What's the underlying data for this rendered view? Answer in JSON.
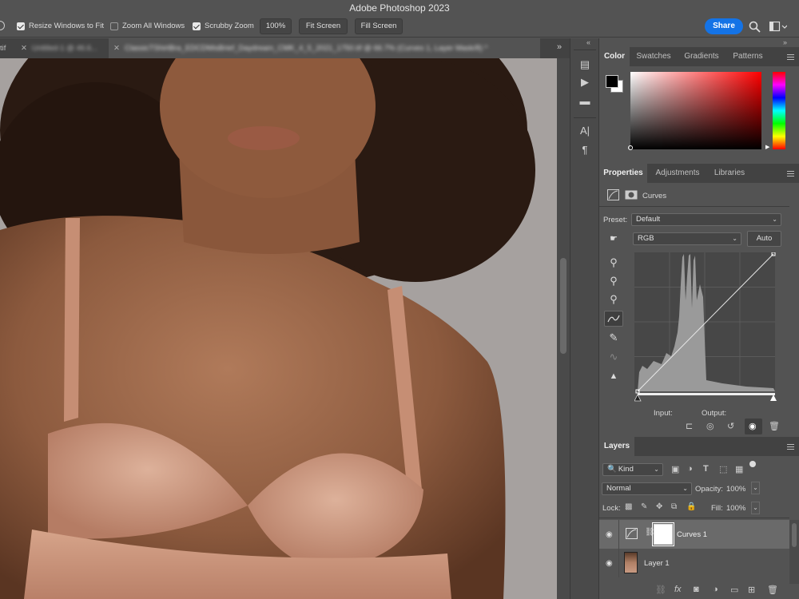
{
  "app": {
    "title": "Adobe Photoshop 2023"
  },
  "options_bar": {
    "resize_windows": {
      "label": "Resize Windows to Fit",
      "checked": true
    },
    "zoom_all": {
      "label": "Zoom All Windows",
      "checked": false
    },
    "scrubby_zoom": {
      "label": "Scrubby Zoom",
      "checked": true
    },
    "zoom_value": "100%",
    "fit_screen": "Fit Screen",
    "fill_screen": "Fill Screen",
    "share": "Share",
    "partial_left": "tif"
  },
  "doc_tabs": [
    {
      "label": "Untitled-1 @ 46.6..."
    },
    {
      "label": "ClassicTShirtBra_EDCDMisBrief_Daydream_CMK_4_5_2021_1750.tif @ 66.7% (Curves 1, Layer Mask/8) *"
    }
  ],
  "color_panel": {
    "tabs": [
      "Color",
      "Swatches",
      "Gradients",
      "Patterns"
    ],
    "active_tab": "Color",
    "foreground": "#000000",
    "background": "#ffffff",
    "hue_color": "#ff0000"
  },
  "properties_panel": {
    "tabs": [
      "Properties",
      "Adjustments",
      "Libraries"
    ],
    "active_tab": "Properties",
    "adjustment_name": "Curves",
    "preset_label": "Preset:",
    "preset_value": "Default",
    "channel_value": "RGB",
    "auto_label": "Auto",
    "input_label": "Input:",
    "output_label": "Output:"
  },
  "layers_panel": {
    "title": "Layers",
    "filter_label": "Kind",
    "blend_mode": "Normal",
    "opacity_label": "Opacity:",
    "opacity_value": "100%",
    "lock_label": "Lock:",
    "fill_label": "Fill:",
    "fill_value": "100%",
    "layers": [
      {
        "name": "Curves 1",
        "selected": true,
        "visible": true
      },
      {
        "name": "Layer 1",
        "selected": false,
        "visible": true
      }
    ]
  },
  "icons": {
    "search": "search-icon",
    "workspace": "workspace-icon",
    "eye": "eye-icon"
  }
}
